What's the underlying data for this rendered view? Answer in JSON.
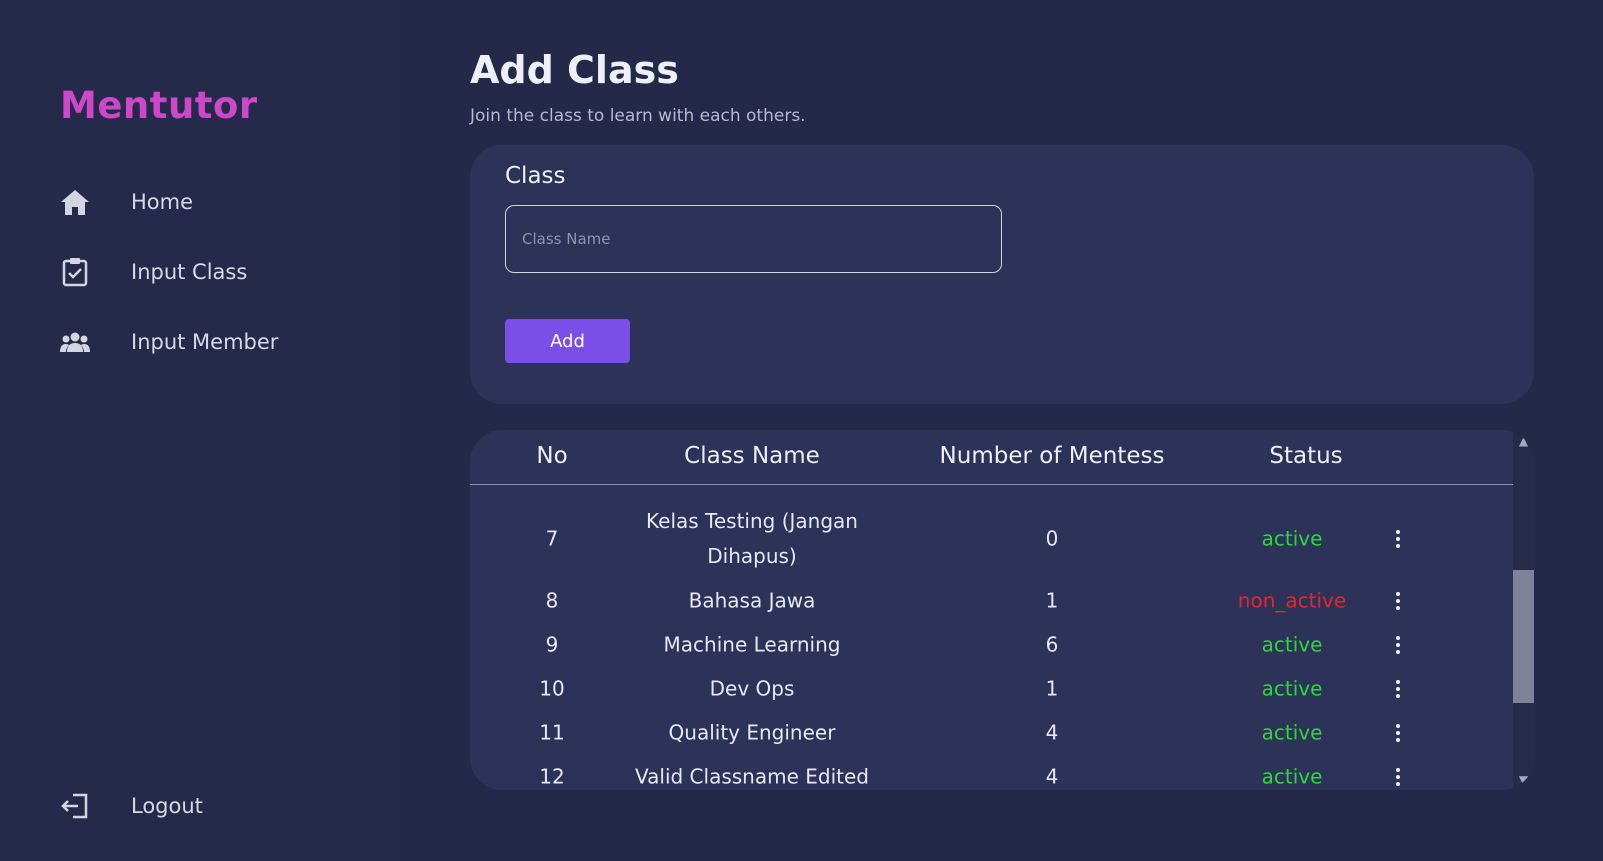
{
  "sidebar": {
    "logo": "Mentutor",
    "items": [
      {
        "label": "Home",
        "icon": "home-icon"
      },
      {
        "label": "Input Class",
        "icon": "clipboard-check-icon"
      },
      {
        "label": "Input Member",
        "icon": "users-icon"
      }
    ],
    "logout": {
      "label": "Logout",
      "icon": "logout-icon"
    }
  },
  "header": {
    "title": "Add Class",
    "subtitle": "Join the class to learn with each others."
  },
  "form": {
    "label": "Class",
    "input_placeholder": "Class Name",
    "input_value": "",
    "add_label": "Add"
  },
  "table": {
    "columns": [
      "No",
      "Class Name",
      "Number of Mentess",
      "Status"
    ],
    "rows": [
      {
        "no": "7",
        "name": "Kelas Testing (Jangan Dihapus)",
        "mentees": "0",
        "status": "active"
      },
      {
        "no": "8",
        "name": "Bahasa Jawa",
        "mentees": "1",
        "status": "non_active"
      },
      {
        "no": "9",
        "name": "Machine Learning",
        "mentees": "6",
        "status": "active"
      },
      {
        "no": "10",
        "name": "Dev Ops",
        "mentees": "1",
        "status": "active"
      },
      {
        "no": "11",
        "name": "Quality Engineer",
        "mentees": "4",
        "status": "active"
      },
      {
        "no": "12",
        "name": "Valid Classname Edited",
        "mentees": "4",
        "status": "active"
      }
    ]
  },
  "colors": {
    "background": "#242849",
    "card": "#2d3258",
    "accent": "#7b4ee8",
    "logo": "#cc48c8",
    "status_active": "#2bd83a",
    "status_non_active": "#e5252e"
  }
}
